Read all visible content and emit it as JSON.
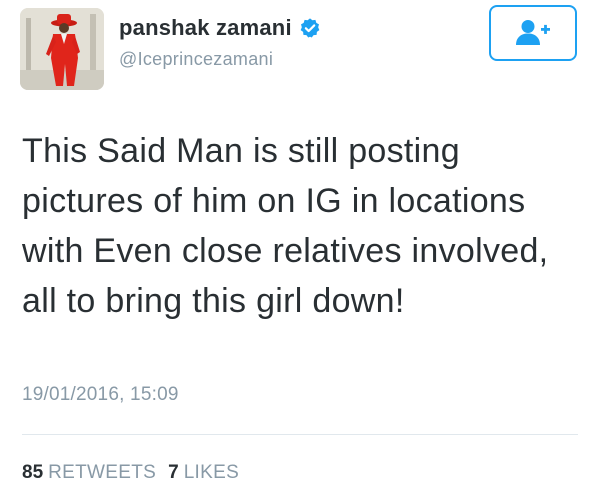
{
  "tweet": {
    "author": {
      "display_name": "panshak zamani",
      "handle": "@Iceprincezamani",
      "verified": true,
      "avatar_icon": "person-in-red-suit-avatar"
    },
    "follow_button": {
      "icon": "add-user-icon"
    },
    "text": "This Said Man is still posting pictures of him on IG in locations with Even close relatives involved, all to bring this girl down!",
    "timestamp": "19/01/2016, 15:09",
    "stats": {
      "retweets_count": "85",
      "retweets_label": "RETWEETS",
      "likes_count": "7",
      "likes_label": "LIKES"
    }
  },
  "colors": {
    "accent": "#1da1f2",
    "text": "#292f33",
    "muted": "#8899a6",
    "divider": "#e1e8ed",
    "avatar_suit": "#e0251b"
  }
}
